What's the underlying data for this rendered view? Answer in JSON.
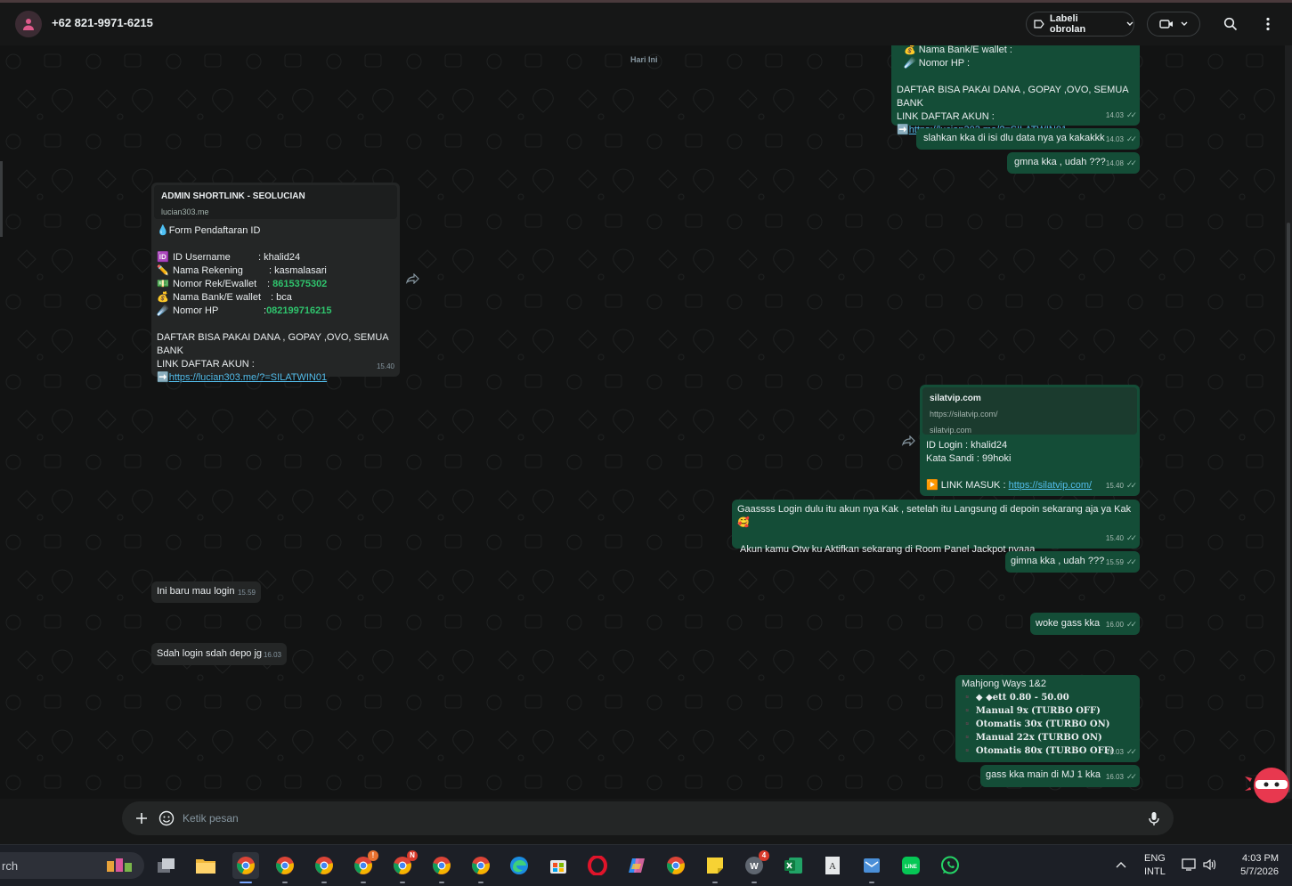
{
  "header": {
    "contact": "+62 821-9971-6215",
    "label_button": "Labeli obrolan"
  },
  "chat": {
    "day_chip": "Hari Ini",
    "m1": {
      "lines": [
        "Nama Bank/E wallet   :",
        "Nomor HP                  :"
      ],
      "body1": "DAFTAR BISA PAKAI DANA , GOPAY ,OVO, SEMUA BANK",
      "body2": "LINK DAFTAR AKUN :",
      "link": "https://lucian303.me/?=SILATWIN01",
      "time": "14.03"
    },
    "m2": {
      "text": "slahkan kka di isi dlu data nya ya kakakkk",
      "time": "14.03"
    },
    "m3": {
      "text": "gmna kka , udah ???",
      "time": "14.08"
    },
    "m4": {
      "preview_title": "ADMIN SHORTLINK - SEOLUCIAN",
      "preview_sub": "lucian303.me",
      "form_title": "Form Pendaftaran ID",
      "rows": [
        {
          "label": "ID Username",
          "value": "khalid24",
          "sep": ":"
        },
        {
          "label": "Nama Rekening",
          "value": "kasmalasari",
          "sep": ":"
        },
        {
          "label": "Nomor Rek/Ewallet",
          "value": "8615375302",
          "sep": ":"
        },
        {
          "label": "Nama Bank/E wallet",
          "value": "bca",
          "sep": ":"
        },
        {
          "label": "Nomor HP",
          "value": "082199716215",
          "sep": ":"
        }
      ],
      "body1": "DAFTAR BISA PAKAI DANA , GOPAY ,OVO, SEMUA BANK",
      "body2": "LINK DAFTAR AKUN :",
      "link": "https://lucian303.me/?=SILATWIN01",
      "time": "15.40"
    },
    "m5": {
      "preview_title": "silatvip.com",
      "preview_url": "https://silatvip.com/",
      "preview_domain": "silatvip.com",
      "line1": "ID Login : khalid24",
      "line2": "Kata Sandi : 99hoki",
      "link_label": "LINK MASUK  :",
      "link": "https://silatvip.com/",
      "time": "15.40"
    },
    "m6": {
      "line1": "Gaassss Login dulu itu akun nya Kak  , setelah itu Langsung di depoin sekarang aja ya Kak",
      "line2": "Akun kamu Otw ku Aktifkan sekarang di Room Panel Jackpot nyaaa",
      "time": "15.40"
    },
    "m7": {
      "text": "gimna kka , udah ???",
      "time": "15.59"
    },
    "m8": {
      "text": "Ini baru mau login",
      "time": "15.59"
    },
    "m9": {
      "text": "woke gass kka",
      "time": "16.00"
    },
    "m10": {
      "text": "Sdah login sdah depo jg",
      "time": "16.03"
    },
    "m11": {
      "title": "Mahjong Ways 1&2",
      "rows": [
        "▪️ ◆ ◆ett 0.80 - 50.00",
        "▪️  Manual     9x (TURBO OFF)",
        "▪️  Otomatis 30x (TURBO ON)",
        "▪️  Manual    22x (TURBO ON)",
        "▪️  Otomatis 80x (TURBO OFF)"
      ],
      "time": "16.03"
    },
    "m12": {
      "text": "gass kka main di MJ 1 kka",
      "time": "16.03"
    }
  },
  "composer": {
    "placeholder": "Ketik pesan"
  },
  "taskbar": {
    "search_text": "rch",
    "badges": {
      "chrome4": "!",
      "chrome5": "N",
      "app_notify": "4"
    },
    "lang_top": "ENG",
    "lang_bottom": "INTL",
    "time": "4:03 PM",
    "date": "5/7/2026"
  },
  "colors": {
    "bubble_out": "#144d37",
    "bubble_in": "#242626",
    "link": "#53bdeb",
    "accent_green": "#2fc46d"
  }
}
